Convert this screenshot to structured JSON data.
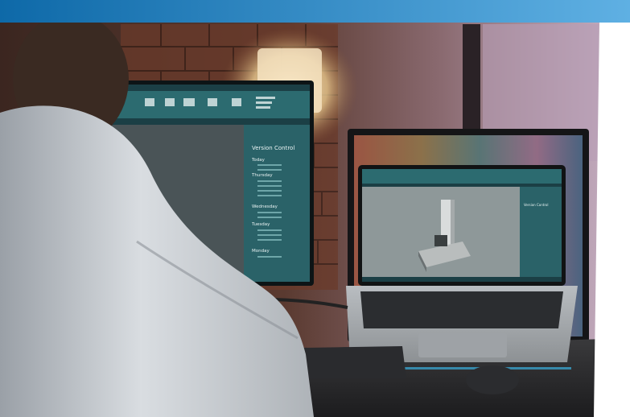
{
  "monitor_panel": {
    "title": "Version Control",
    "days": [
      {
        "label": "Today",
        "entries": 2
      },
      {
        "label": "Thursday",
        "entries": 4
      },
      {
        "label": "Wednesday",
        "entries": 2
      },
      {
        "label": "Tuesday",
        "entries": 3
      },
      {
        "label": "Monday",
        "entries": 1
      }
    ]
  },
  "laptop_panel": {
    "title": "Version Control"
  },
  "colors": {
    "banner_top": "#0e69a8",
    "banner_bottom": "#5fb0e3",
    "cad_dark": "#1b3f45",
    "cad_teal": "#2c6b70",
    "viewport_gray": "#8e9899",
    "brick": "#6a3a2a"
  }
}
